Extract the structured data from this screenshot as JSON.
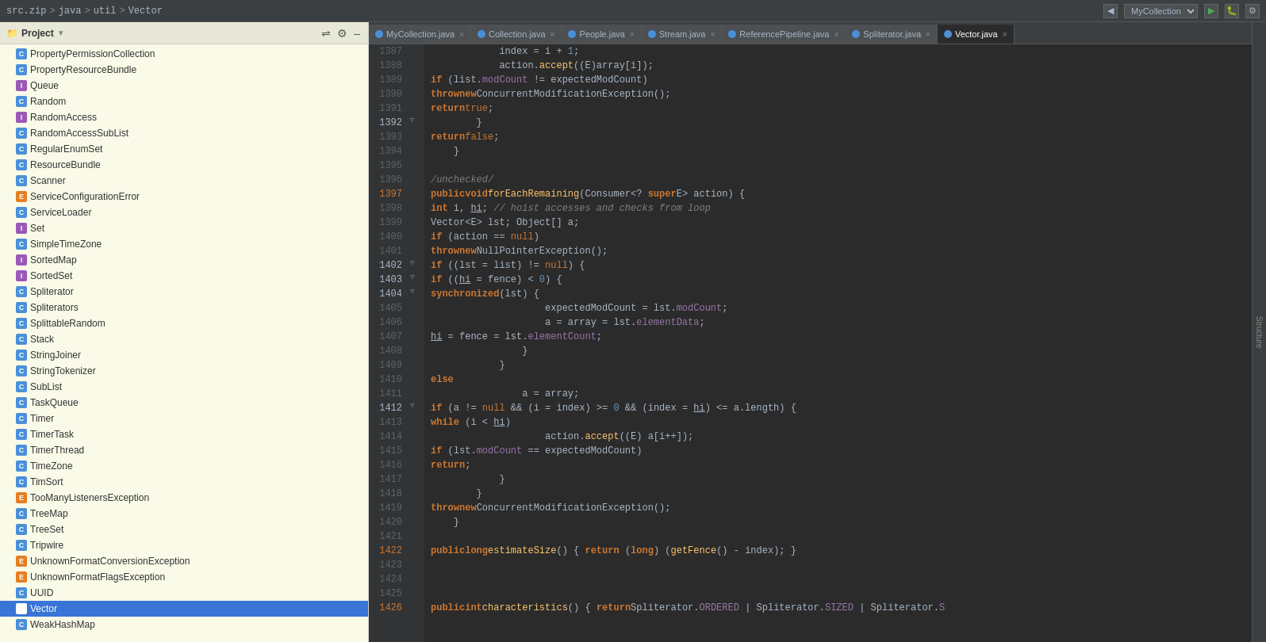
{
  "topbar": {
    "breadcrumb": [
      "src.zip",
      "java",
      "util",
      "Vector"
    ],
    "project_label": "MyCollection",
    "seps": [
      ">",
      ">",
      ">"
    ]
  },
  "tabs": [
    {
      "label": "MyCollection.java",
      "color": "#4a90d9",
      "active": true,
      "closable": true
    },
    {
      "label": "Collection.java",
      "color": "#4a90d9",
      "active": false,
      "closable": true
    },
    {
      "label": "People.java",
      "color": "#4a90d9",
      "active": false,
      "closable": true
    },
    {
      "label": "Stream.java",
      "color": "#4a90d9",
      "active": false,
      "closable": true
    },
    {
      "label": "ReferencePipeline.java",
      "color": "#4a90d9",
      "active": false,
      "closable": true
    },
    {
      "label": "Spliterator.java",
      "color": "#4a90d9",
      "active": false,
      "closable": true
    },
    {
      "label": "Vector.java",
      "color": "#4a90d9",
      "active": true,
      "closable": true
    }
  ],
  "sidebar": {
    "title": "Project",
    "items": [
      {
        "name": "PropertyPermissionCollection",
        "icon": "c"
      },
      {
        "name": "PropertyResourceBundle",
        "icon": "c"
      },
      {
        "name": "Queue",
        "icon": "i"
      },
      {
        "name": "Random",
        "icon": "c"
      },
      {
        "name": "RandomAccess",
        "icon": "i"
      },
      {
        "name": "RandomAccessSubList",
        "icon": "c"
      },
      {
        "name": "RegularEnumSet",
        "icon": "c"
      },
      {
        "name": "ResourceBundle",
        "icon": "c"
      },
      {
        "name": "Scanner",
        "icon": "c"
      },
      {
        "name": "ServiceConfigurationError",
        "icon": "e"
      },
      {
        "name": "ServiceLoader",
        "icon": "c"
      },
      {
        "name": "Set",
        "icon": "i"
      },
      {
        "name": "SimpleTimeZone",
        "icon": "c"
      },
      {
        "name": "SortedMap",
        "icon": "i"
      },
      {
        "name": "SortedSet",
        "icon": "i"
      },
      {
        "name": "Spliterator",
        "icon": "c"
      },
      {
        "name": "Spliterators",
        "icon": "c"
      },
      {
        "name": "SplittableRandom",
        "icon": "c"
      },
      {
        "name": "Stack",
        "icon": "c"
      },
      {
        "name": "StringJoiner",
        "icon": "c"
      },
      {
        "name": "StringTokenizer",
        "icon": "c"
      },
      {
        "name": "SubList",
        "icon": "c"
      },
      {
        "name": "TaskQueue",
        "icon": "c"
      },
      {
        "name": "Timer",
        "icon": "c"
      },
      {
        "name": "TimerTask",
        "icon": "c"
      },
      {
        "name": "TimerThread",
        "icon": "c"
      },
      {
        "name": "TimeZone",
        "icon": "c"
      },
      {
        "name": "TimSort",
        "icon": "c"
      },
      {
        "name": "TooManyListenersException",
        "icon": "e"
      },
      {
        "name": "TreeMap",
        "icon": "c"
      },
      {
        "name": "TreeSet",
        "icon": "c"
      },
      {
        "name": "Tripwire",
        "icon": "c"
      },
      {
        "name": "UnknownFormatConversionException",
        "icon": "e"
      },
      {
        "name": "UnknownFormatFlagsException",
        "icon": "e"
      },
      {
        "name": "UUID",
        "icon": "c"
      },
      {
        "name": "Vector",
        "icon": "c",
        "selected": true
      },
      {
        "name": "WeakHashMap",
        "icon": "c"
      }
    ]
  },
  "structure_panel_label": "Structure",
  "lines": [
    {
      "num": 1387,
      "gutter": "",
      "code": "            index = i + 1;",
      "tokens": [
        {
          "text": "            index = i + ",
          "class": "type"
        },
        {
          "text": "1",
          "class": "num"
        },
        {
          "text": ";",
          "class": "type"
        }
      ]
    },
    {
      "num": 1388,
      "gutter": "",
      "code": "            action.accept((E)array[i]);"
    },
    {
      "num": 1389,
      "gutter": "",
      "code": "            if (list.modCount != expectedModCount)"
    },
    {
      "num": 1390,
      "gutter": "",
      "code": "                throw new ConcurrentModificationException();"
    },
    {
      "num": 1391,
      "gutter": "",
      "code": "            return true;"
    },
    {
      "num": 1392,
      "gutter": "fold",
      "code": "        }"
    },
    {
      "num": 1393,
      "gutter": "",
      "code": "        return false;"
    },
    {
      "num": 1394,
      "gutter": "",
      "code": "    }"
    },
    {
      "num": 1395,
      "gutter": "",
      "code": ""
    },
    {
      "num": 1396,
      "gutter": "",
      "code": "    /unchecked/"
    },
    {
      "num": 1397,
      "gutter": "mark_anno",
      "code": "    public void forEachRemaining(Consumer<? super E> action) {"
    },
    {
      "num": 1398,
      "gutter": "",
      "code": "        int i, hi; // hoist accesses and checks from loop"
    },
    {
      "num": 1399,
      "gutter": "",
      "code": "        Vector<E> lst; Object[] a;"
    },
    {
      "num": 1400,
      "gutter": "",
      "code": "        if (action == null)"
    },
    {
      "num": 1401,
      "gutter": "",
      "code": "            throw new NullPointerException();"
    },
    {
      "num": 1402,
      "gutter": "fold",
      "code": "        if ((lst = list) != null) {"
    },
    {
      "num": 1403,
      "gutter": "fold",
      "code": "            if ((hi = fence) < 0) {"
    },
    {
      "num": 1404,
      "gutter": "fold",
      "code": "                synchronized(lst) {"
    },
    {
      "num": 1405,
      "gutter": "",
      "code": "                    expectedModCount = lst.modCount;"
    },
    {
      "num": 1406,
      "gutter": "",
      "code": "                    a = array = lst.elementData;"
    },
    {
      "num": 1407,
      "gutter": "",
      "code": "                    hi = fence = lst.elementCount;"
    },
    {
      "num": 1408,
      "gutter": "",
      "code": "                }"
    },
    {
      "num": 1409,
      "gutter": "",
      "code": "            }"
    },
    {
      "num": 1410,
      "gutter": "",
      "code": "            else"
    },
    {
      "num": 1411,
      "gutter": "",
      "code": "                a = array;"
    },
    {
      "num": 1412,
      "gutter": "fold",
      "code": "            if (a != null && (i = index) >= 0 && (index = hi) <= a.length) {"
    },
    {
      "num": 1413,
      "gutter": "",
      "code": "                while (i < hi)"
    },
    {
      "num": 1414,
      "gutter": "",
      "code": "                    action.accept((E) a[i++]);"
    },
    {
      "num": 1415,
      "gutter": "",
      "code": "                if (lst.modCount == expectedModCount)"
    },
    {
      "num": 1416,
      "gutter": "",
      "code": "                    return;"
    },
    {
      "num": 1417,
      "gutter": "",
      "code": "            }"
    },
    {
      "num": 1418,
      "gutter": "",
      "code": "        }"
    },
    {
      "num": 1419,
      "gutter": "",
      "code": "        throw new ConcurrentModificationException();"
    },
    {
      "num": 1420,
      "gutter": "",
      "code": "    }"
    },
    {
      "num": 1421,
      "gutter": "",
      "code": ""
    },
    {
      "num": 1422,
      "gutter": "mark",
      "code": "    public long estimateSize() { return (long) (getFence() - index); }"
    },
    {
      "num": 1423,
      "gutter": "",
      "code": ""
    },
    {
      "num": 1424,
      "gutter": "",
      "code": ""
    },
    {
      "num": 1425,
      "gutter": "",
      "code": ""
    },
    {
      "num": 1426,
      "gutter": "mark_anno2",
      "code": "    public int characteristics() { return Spliterator.ORDERED | Spliterator.SIZED | Spliterator.S"
    }
  ]
}
